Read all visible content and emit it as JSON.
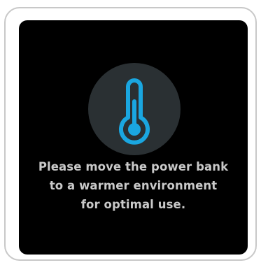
{
  "dialog": {
    "message_lines": [
      "Please move the power bank",
      "to a warmer environment",
      "for optimal use."
    ],
    "icon": "thermometer-icon"
  },
  "colors": {
    "screen_background": "#000000",
    "icon_circle": "#2a3033",
    "icon_accent": "#1aa6e0",
    "text": "#c9c9c9",
    "frame_border": "#c8c8c8"
  }
}
